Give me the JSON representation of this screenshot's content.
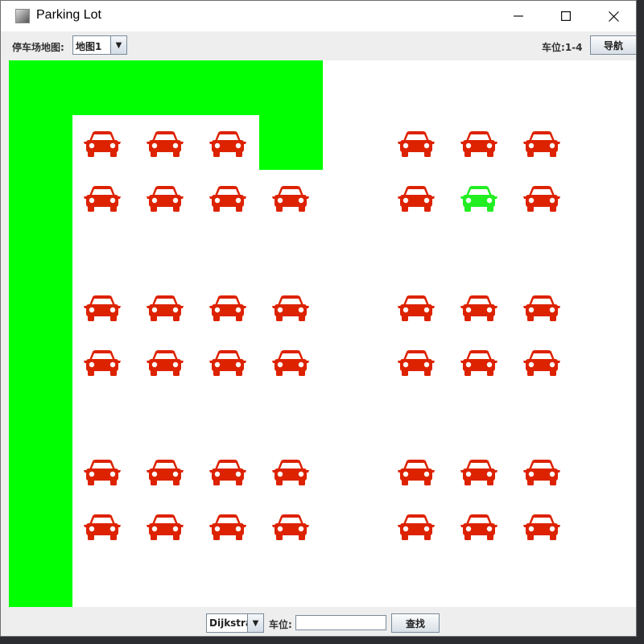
{
  "window": {
    "title": "Parking Lot",
    "icon": "java-app-icon"
  },
  "title_controls": {
    "minimize": "—",
    "maximize": "☐",
    "close": "✕"
  },
  "toolbar": {
    "map_label": "停车场地图:",
    "map_select_value": "地图1",
    "spot_label": "车位:",
    "spot_value": "1-4",
    "nav_button": "导航"
  },
  "map": {
    "road_color": "#00ff00",
    "occupied_color": "#dd2200",
    "target_color": "#22ee22",
    "target_spot": "1-4",
    "rows": [
      {
        "left": [
          "occupied",
          "occupied",
          "occupied",
          null
        ],
        "right": [
          "occupied",
          "occupied",
          "occupied"
        ]
      },
      {
        "left": [
          "occupied",
          "occupied",
          "occupied",
          "occupied"
        ],
        "right": [
          "occupied",
          "target",
          "occupied"
        ]
      },
      {
        "left": [
          "occupied",
          "occupied",
          "occupied",
          "occupied"
        ],
        "right": [
          "occupied",
          "occupied",
          "occupied"
        ]
      },
      {
        "left": [
          "occupied",
          "occupied",
          "occupied",
          "occupied"
        ],
        "right": [
          "occupied",
          "occupied",
          "occupied"
        ]
      },
      {
        "left": [
          "occupied",
          "occupied",
          "occupied",
          "occupied"
        ],
        "right": [
          "occupied",
          "occupied",
          "occupied"
        ]
      },
      {
        "left": [
          "occupied",
          "occupied",
          "occupied",
          "occupied"
        ],
        "right": [
          "occupied",
          "occupied",
          "occupied"
        ]
      }
    ]
  },
  "bottom": {
    "algorithm_value": "Dijkstra",
    "spot_label": "车位:",
    "spot_input_value": "",
    "search_button": "查找"
  }
}
